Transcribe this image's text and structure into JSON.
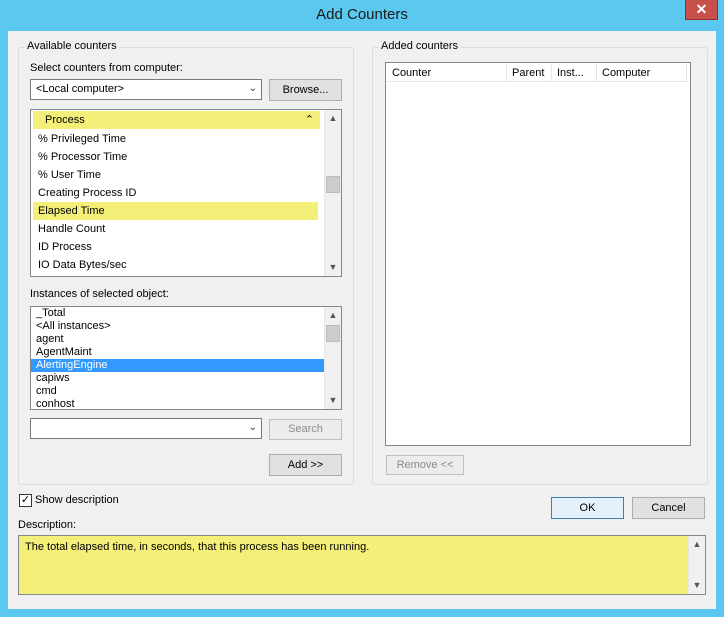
{
  "window": {
    "title": "Add Counters",
    "close_glyph": "✕"
  },
  "available": {
    "group_label": "Available counters",
    "computer_label": "Select counters from computer:",
    "computer_value": "<Local computer>",
    "browse_label": "Browse...",
    "object_header": "Process",
    "counters": [
      "% Privileged Time",
      "% Processor Time",
      "% User Time",
      "Creating Process ID",
      "Elapsed Time",
      "Handle Count",
      "ID Process",
      "IO Data Bytes/sec"
    ],
    "selected_counter": "Elapsed Time",
    "instances_label": "Instances of selected object:",
    "instances": [
      "_Total",
      "<All instances>",
      "agent",
      "AgentMaint",
      "AlertingEngine",
      "capiws",
      "cmd",
      "conhost"
    ],
    "selected_instance": "AlertingEngine",
    "search_value": "",
    "search_label": "Search",
    "add_label": "Add >>"
  },
  "added": {
    "group_label": "Added counters",
    "columns": [
      "Counter",
      "Parent",
      "Inst...",
      "Computer"
    ],
    "remove_label": "Remove <<"
  },
  "show_description": {
    "label": "Show description",
    "checked": true
  },
  "description": {
    "label": "Description:",
    "text": "The total elapsed time, in seconds, that this process has been running."
  },
  "actions": {
    "ok_label": "OK",
    "cancel_label": "Cancel"
  },
  "colors": {
    "title_bar": "#5bc8ef",
    "highlight_yellow": "#f3ef79",
    "selection_blue": "#3399ff",
    "close_red": "#c7504a"
  }
}
